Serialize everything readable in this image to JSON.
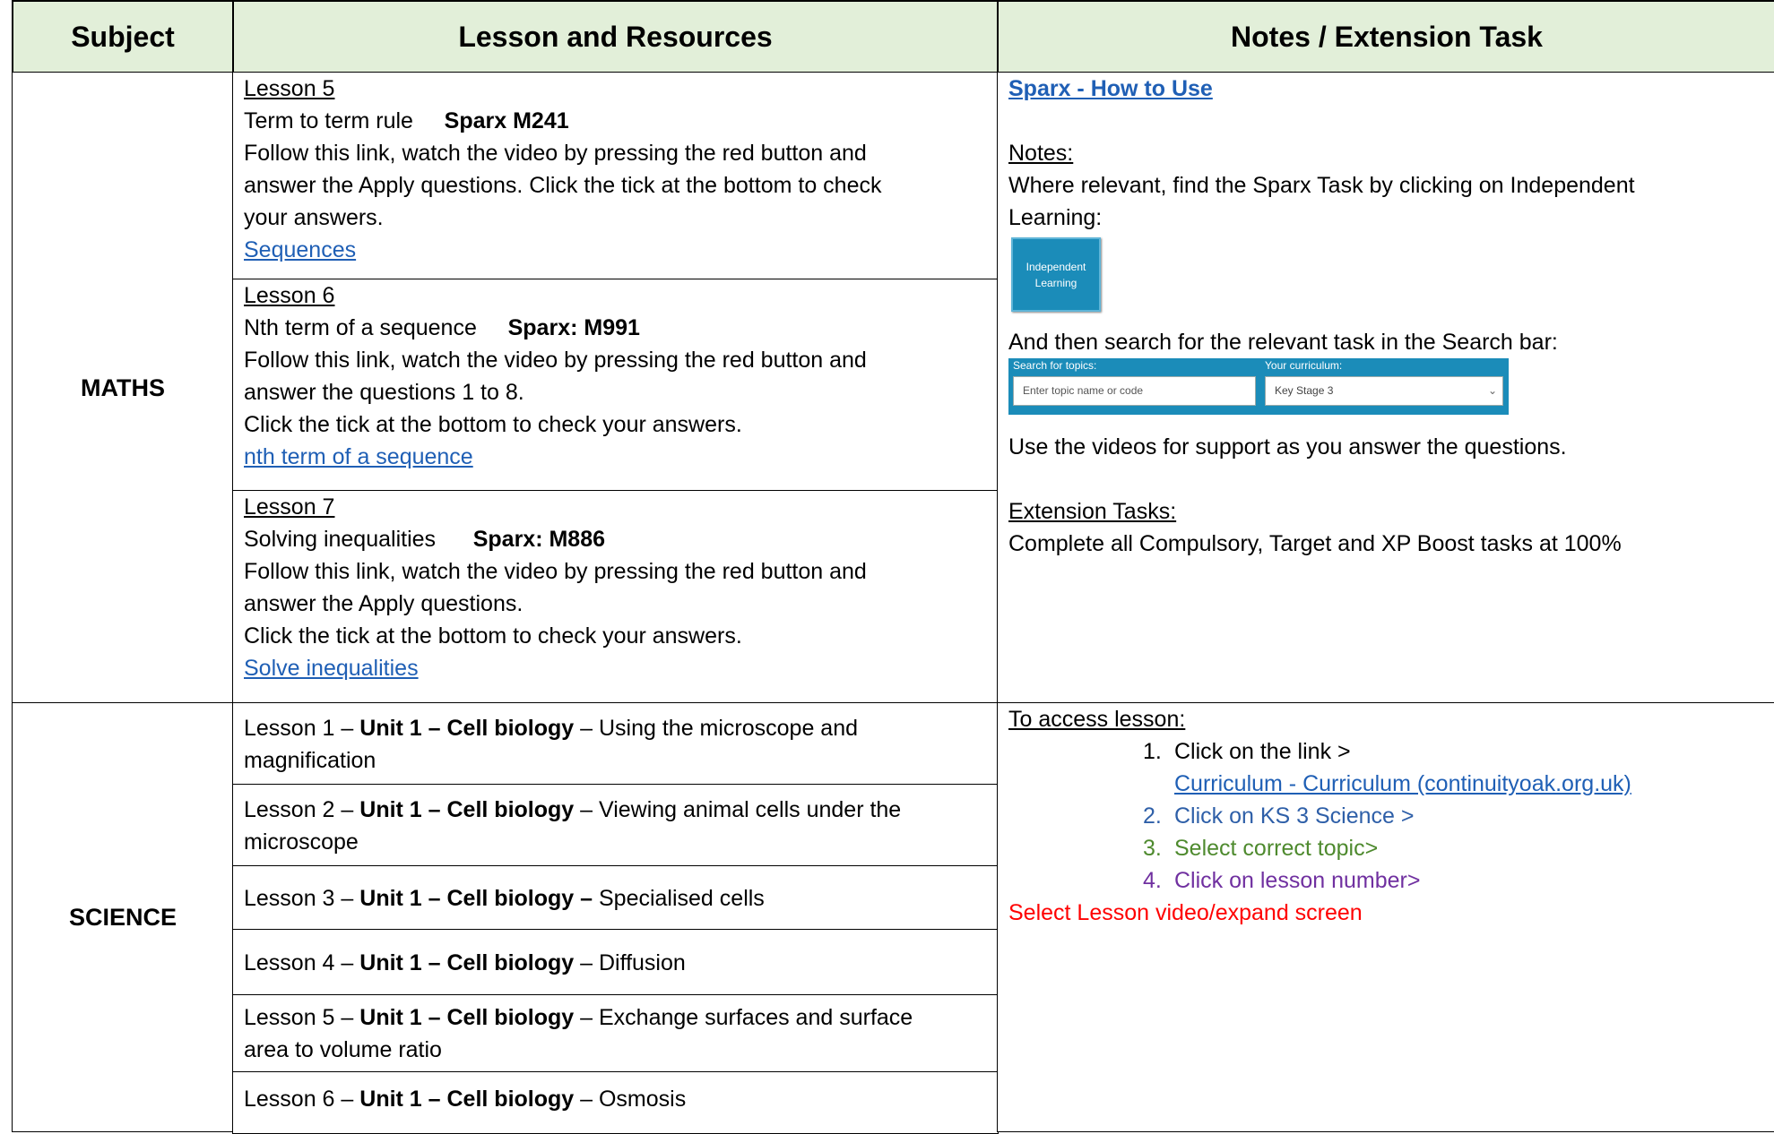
{
  "header": {
    "subject": "Subject",
    "lesson": "Lesson and Resources",
    "notes": "Notes / Extension Task"
  },
  "maths": {
    "subject": "MATHS",
    "lessons": [
      {
        "title": "Lesson 5",
        "topic": "Term to term rule",
        "code": "Sparx M241",
        "lines": [
          "Follow this link, watch the video by pressing the red button and",
          "answer the Apply questions. Click the tick at the bottom to check",
          "your answers."
        ],
        "link": "Sequences"
      },
      {
        "title": "Lesson 6",
        "topic": "Nth term of a sequence",
        "code": "Sparx: M991",
        "lines": [
          "Follow this link, watch the video by pressing the red button and",
          "answer the questions 1 to 8.",
          "Click the tick at the bottom to check your answers."
        ],
        "link": "nth term of a sequence"
      },
      {
        "title": "Lesson 7",
        "topic": "Solving inequalities",
        "code": "Sparx: M886",
        "lines": [
          "Follow this link, watch the video by pressing the red button and",
          "answer the Apply questions.",
          "Click the tick at the bottom to check your answers."
        ],
        "link": "Solve inequalities"
      }
    ],
    "notes": {
      "howto_link": "Sparx - How to Use",
      "notes_heading": "Notes:",
      "notes_line1": "Where relevant, find the Sparx Task by clicking on Independent",
      "notes_line2": "Learning:",
      "button_line1": "Independent",
      "button_line2": "Learning",
      "search_line": "And then search for the relevant task in the Search bar:",
      "search_label": "Search for topics:",
      "search_placeholder": "Enter topic name or code",
      "curriculum_label": "Your curriculum:",
      "curriculum_value": "Key Stage 3",
      "chevron_icon": "chevron-down-icon",
      "videos_line": "Use the videos for support as you answer the questions.",
      "extension_heading": "Extension Tasks:",
      "extension_line": "Complete all Compulsory, Target and XP Boost tasks at 100%"
    }
  },
  "science": {
    "subject": "SCIENCE",
    "lessons": [
      {
        "prefix": "Lesson 1 – ",
        "unit": "Unit 1 – Cell biology",
        "sep": " – ",
        "line1": "Using the microscope and",
        "line2": "magnification"
      },
      {
        "prefix": "Lesson 2 – ",
        "unit": "Unit 1 – Cell biology",
        "sep": " – ",
        "line1": "Viewing animal cells under the",
        "line2": "microscope"
      },
      {
        "prefix": "Lesson 3 – ",
        "unit": "Unit 1 – Cell biology –",
        "sep": " ",
        "line1": "Specialised cells",
        "line2": ""
      },
      {
        "prefix": "Lesson 4 – ",
        "unit": "Unit 1 – Cell biology",
        "sep": " – ",
        "line1": "Diffusion",
        "line2": ""
      },
      {
        "prefix": "Lesson 5 – ",
        "unit": "Unit 1 – Cell biology",
        "sep": " – ",
        "line1": "Exchange surfaces and surface",
        "line2": "area to volume ratio"
      },
      {
        "prefix": "Lesson 6 – ",
        "unit": "Unit 1 – Cell biology",
        "sep": " – ",
        "line1": "Osmosis",
        "line2": ""
      }
    ],
    "notes": {
      "heading": "To access lesson:",
      "steps": [
        {
          "num": "1.",
          "text": "Click on the link >",
          "color": "#000000"
        },
        {
          "num": "2.",
          "text": "Click on KS 3 Science >",
          "color": "#2e5fa8"
        },
        {
          "num": "3.",
          "text": "Select correct topic>",
          "color": "#4e8a2e"
        },
        {
          "num": "4.",
          "text": "Click on lesson number>",
          "color": "#7030a0"
        }
      ],
      "curriculum_link": "Curriculum - Curriculum (continuityoak.org.uk)",
      "final_line": "Select Lesson video/expand screen",
      "final_color": "#ff0000"
    }
  }
}
